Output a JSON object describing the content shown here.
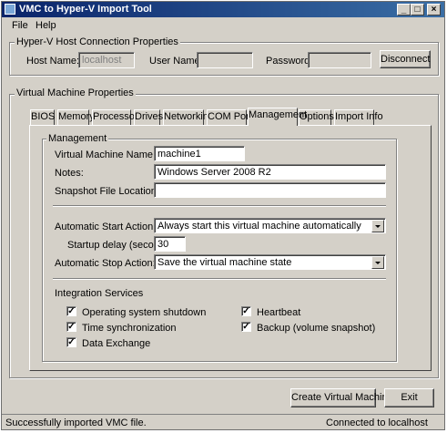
{
  "window": {
    "title": "VMC to Hyper-V Import Tool"
  },
  "menu": [
    "File",
    "Help"
  ],
  "connection": {
    "group_title": "Hyper-V Host Connection Properties",
    "host_label": "Host Name:",
    "host_value": "localhost",
    "user_label": "User Name:",
    "user_value": "",
    "password_label": "Password:",
    "password_value": "",
    "disconnect_label": "Disconnect"
  },
  "vm": {
    "group_title": "Virtual Machine Properties",
    "tabs": [
      "BIOS",
      "Memory",
      "Processor",
      "Drives",
      "Networking",
      "COM Ports",
      "Management",
      "Options",
      "Import Info"
    ],
    "active_tab": "Management"
  },
  "management": {
    "group_title": "Management",
    "vm_name_label": "Virtual Machine Name:",
    "vm_name_value": "machine1",
    "notes_label": "Notes:",
    "notes_value": "Windows Server 2008 R2",
    "snapshot_label": "Snapshot File Location:",
    "snapshot_value": "",
    "auto_start_label": "Automatic Start Action:",
    "auto_start_value": "Always start this virtual machine automatically",
    "startup_delay_label": "Startup delay (seconds):",
    "startup_delay_value": "30",
    "auto_stop_label": "Automatic Stop Action:",
    "auto_stop_value": "Save the virtual machine state",
    "integration_title": "Integration Services",
    "services": [
      {
        "label": "Operating system shutdown",
        "checked": true
      },
      {
        "label": "Time synchronization",
        "checked": true
      },
      {
        "label": "Data Exchange",
        "checked": true
      },
      {
        "label": "Heartbeat",
        "checked": true
      },
      {
        "label": "Backup (volume snapshot)",
        "checked": true
      }
    ]
  },
  "actions": {
    "create_label": "Create Virtual Machine",
    "exit_label": "Exit"
  },
  "status": {
    "left": "Successfully imported VMC file.",
    "right": "Connected to localhost"
  },
  "colors": {
    "face": "#d4d0c8",
    "title_start": "#0a246a",
    "title_end": "#3a6ea5"
  }
}
